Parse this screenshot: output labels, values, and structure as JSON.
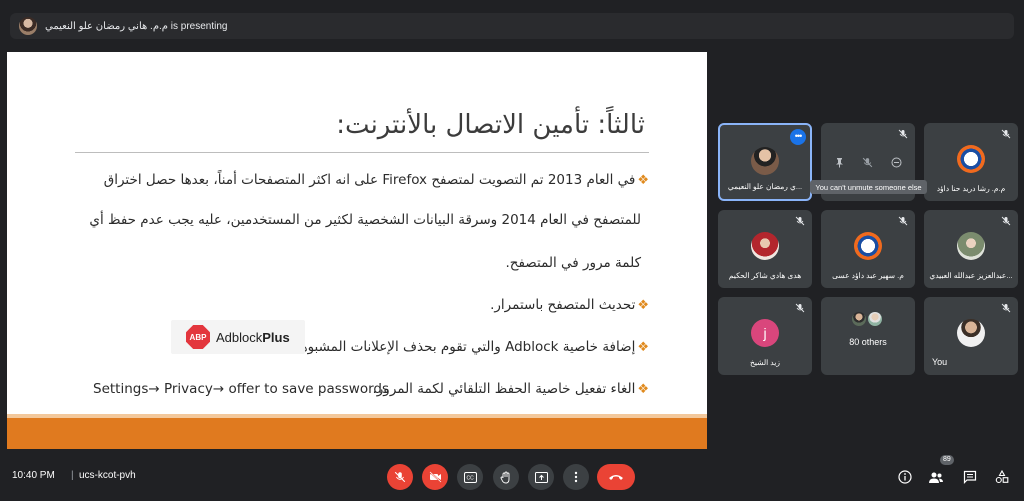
{
  "presenting": {
    "name": "م.م. هاني رمضان علو النعيمي",
    "suffix": " is presenting"
  },
  "slide": {
    "title": "ثالثاً: تأمين الاتصال بالأنترنت:",
    "bullet_glyph": "❖",
    "lines": [
      "في العام 2013 تم التصويت لمتصفح Firefox على انه اكثر المتصفحات أمناً، بعدها حصل اختراق",
      "للمتصفح في العام 2014 وسرقة البيانات الشخصية لكثير من المستخدمين، عليه يجب عدم حفظ أي",
      "كلمة مرور في المتصفح.",
      "تحديث المتصفح باستمرار.",
      "إضافة خاصية Adblock والتي تقوم بحذف الإعلانات المشبوهة.",
      "الغاء تفعيل خاصية  الحفظ التلقائي لكمة المرور."
    ],
    "settings_path": "Settings→ Privacy→ offer to save passwords",
    "adblock": {
      "icon_text": "ABP",
      "name_regular": "Adblock",
      "name_bold": "Plus"
    }
  },
  "participants": [
    {
      "name": "...ي رمضان علو النعيمي",
      "avatar": "photo"
    },
    {
      "name": "م.م. رشا دريد حنا داؤد",
      "avatar": "logo"
    },
    {
      "name": "هدى هادي شاكر الحكيم",
      "avatar": "hijab-red"
    },
    {
      "name": "م. سهير عبد داؤد عسى",
      "avatar": "logo"
    },
    {
      "name": "...عبدالعزيز عبدالله العبيدي",
      "avatar": "hijab-grey"
    },
    {
      "name": "زيد الشيخ",
      "avatar_letter": "j"
    },
    {
      "name": "80 others"
    },
    {
      "name": "You"
    }
  ],
  "hover_tooltip": "You can't unmute someone else",
  "more_options": "•••",
  "bottombar": {
    "time": "10:40 PM",
    "separator": "|",
    "meeting_code": "ucs-kcot-pvh",
    "people_count": "89"
  },
  "colors": {
    "background": "#202124",
    "tile": "#3c4043",
    "accent_red": "#ea4335",
    "active_border": "#8ab4f8",
    "slide_footer": "#e07a1f"
  }
}
